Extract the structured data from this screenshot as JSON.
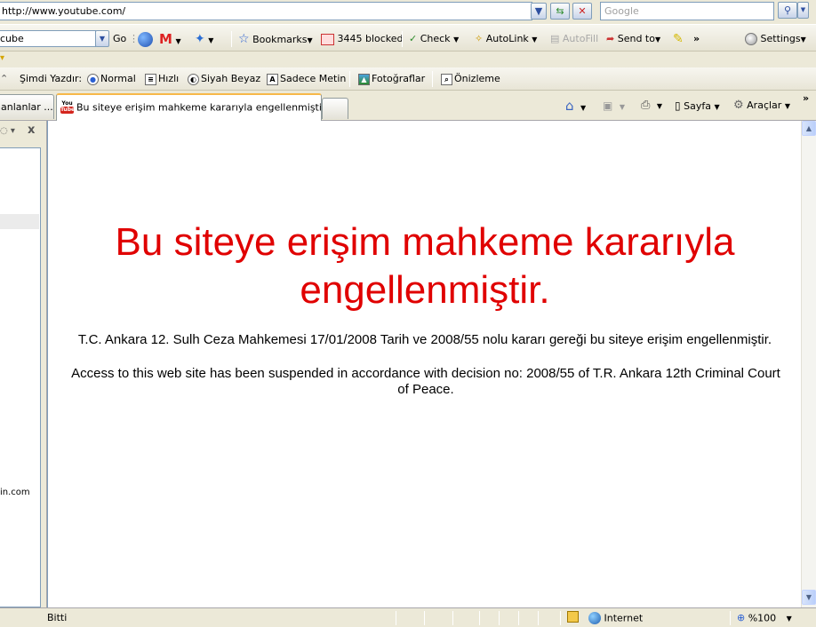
{
  "address_bar": {
    "url": "http://www.youtube.com/",
    "search_placeholder": "Google"
  },
  "google_toolbar": {
    "search_value": "cube",
    "go_label": "Go",
    "bookmarks_label": "Bookmarks",
    "blocked_label": "3445 blocked",
    "check_label": "Check",
    "autolink_label": "AutoLink",
    "autofill_label": "AutoFill",
    "sendto_label": "Send to",
    "more_label": "»",
    "settings_label": "Settings"
  },
  "print_toolbar": {
    "print_now_label": "Şimdi Yazdır:",
    "normal_label": "Normal",
    "fast_label": "Hızlı",
    "bw_label": "Siyah Beyaz",
    "textonly_label": "Sadece Metin",
    "photos_label": "Fotoğraflar",
    "preview_label": "Önizleme"
  },
  "tabs": {
    "items": [
      {
        "label": "anlanlar ..."
      },
      {
        "label": "Bu siteye erişim mahkeme kararıyla engellenmiştir."
      }
    ]
  },
  "command_bar": {
    "page_label": "Sayfa",
    "tools_label": "Araçlar",
    "more_label": "»"
  },
  "sidebar": {
    "close_label": "x",
    "partial_text": "in.com"
  },
  "page": {
    "headline": "Bu siteye erişim mahkeme kararıyla engellenmiştir.",
    "turkish_text": "T.C. Ankara 12. Sulh Ceza Mahkemesi 17/01/2008 Tarih ve 2008/55 nolu kararı gereği bu siteye erişim engellenmiştir.",
    "english_text": "Access to this web site has been suspended in accordance with decision no: 2008/55 of T.R. Ankara 12th Criminal Court of Peace."
  },
  "status_bar": {
    "status_text": "Bitti",
    "zone_label": "Internet",
    "zoom_label": "%100"
  },
  "colors": {
    "headline": "#e00000",
    "chrome": "#ece9d8",
    "border": "#7f9db9"
  }
}
